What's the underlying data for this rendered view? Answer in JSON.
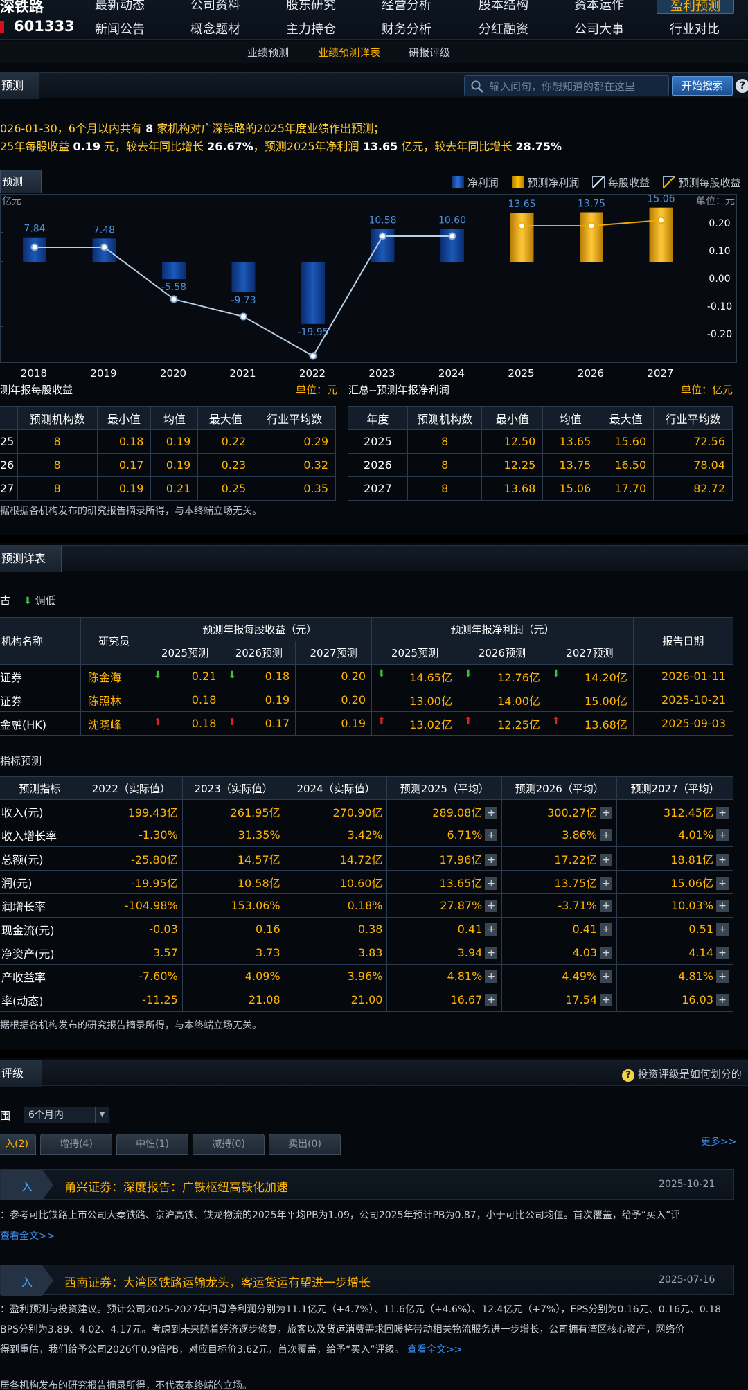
{
  "stock": {
    "name": "深铁路",
    "code": "601333"
  },
  "nav_row1": [
    "最新动态",
    "公司资料",
    "股东研究",
    "经营分析",
    "股本结构",
    "资本运作",
    "盈利预测"
  ],
  "nav_row2": [
    "新闻公告",
    "概念题材",
    "主力持仓",
    "财务分析",
    "分红融资",
    "公司大事",
    "行业对比"
  ],
  "subnav": [
    "业绩预测",
    "业绩预测详表",
    "研报评级"
  ],
  "section1": {
    "title": "预测",
    "search_placeholder": "输入问句，你想知道的都在这里",
    "search_btn": "开始搜索",
    "help": "?"
  },
  "summary": {
    "l1_a": "026-01-30，6个月以内共有",
    "l1_n": "8",
    "l1_b": "家机构对广深铁路的2025年度业绩作出预测；",
    "l2_a": "25年每股收益",
    "l2_v1": "0.19",
    "l2_b": "元，较去年同比增长",
    "l2_v2": "26.67%",
    "l2_c": "，预测2025年净利润",
    "l2_v3": "13.65",
    "l2_d": "亿元，较去年同比增长",
    "l2_v4": "28.75%"
  },
  "chart_tab": "预测",
  "legend": [
    "净利润",
    "预测净利润",
    "每股收益",
    "预测每股收益"
  ],
  "chart_data": {
    "type": "bar",
    "left_unit": "亿元",
    "right_unit": "单位：元",
    "categories": [
      "2018",
      "2019",
      "2020",
      "2021",
      "2022",
      "2023",
      "2024",
      "2025",
      "2026",
      "2027"
    ],
    "net_profit": [
      7.84,
      7.48,
      -5.58,
      -9.73,
      -19.95,
      10.58,
      10.6,
      13.65,
      13.75,
      15.06
    ],
    "forecast_from_index": 7,
    "eps_actual": [
      0.11,
      0.11,
      -0.08,
      -0.14,
      -0.28,
      0.15,
      0.15
    ],
    "eps_forecast": [
      0.19,
      0.19,
      0.21
    ],
    "right_ticks": [
      "0.20",
      "0.10",
      "0.00",
      "-0.10",
      "-0.20"
    ]
  },
  "colors": {
    "actual_bar": "#1c59b8",
    "forecast_bar": "#f2a900",
    "line_actual": "#b8cfe8",
    "line_forecast": "#f2a900",
    "label_actual": "#4e8fd8"
  },
  "eps_table": {
    "title": "测年报每股收益",
    "unit": "单位：元",
    "headers": [
      "",
      "预测机构数",
      "最小值",
      "均值",
      "最大值",
      "行业平均数"
    ],
    "rows": [
      [
        "25",
        "8",
        "0.18",
        "0.19",
        "0.22",
        "0.29"
      ],
      [
        "26",
        "8",
        "0.17",
        "0.19",
        "0.23",
        "0.32"
      ],
      [
        "27",
        "8",
        "0.19",
        "0.21",
        "0.25",
        "0.35"
      ]
    ]
  },
  "np_table": {
    "title": "汇总--预测年报净利润",
    "unit": "单位：亿元",
    "headers": [
      "年度",
      "预测机构数",
      "最小值",
      "均值",
      "最大值",
      "行业平均数"
    ],
    "rows": [
      [
        "2025",
        "8",
        "12.50",
        "13.65",
        "15.60",
        "72.56"
      ],
      [
        "2026",
        "8",
        "12.25",
        "13.75",
        "16.50",
        "78.04"
      ],
      [
        "2027",
        "8",
        "13.68",
        "15.06",
        "17.70",
        "82.72"
      ]
    ]
  },
  "note1": "据根据各机构发布的研究报告摘录所得，与本终端立场无关。",
  "section2": {
    "title": "预测详表",
    "legend_down": "调低"
  },
  "detail": {
    "h_inst": "机构名称",
    "h_analyst": "研究员",
    "h_eps": "预测年报每股收益（元）",
    "h_np": "预测年报净利润（元）",
    "h_date": "报告日期",
    "sub": [
      "2025预测",
      "2026预测",
      "2027预测",
      "2025预测",
      "2026预测",
      "2027预测"
    ],
    "rows": [
      {
        "inst": "证券",
        "analyst": "陈金海",
        "eps": [
          "0.21",
          "0.18",
          "0.20"
        ],
        "np": [
          "14.65亿",
          "12.76亿",
          "14.20亿"
        ],
        "date": "2026-01-11"
      },
      {
        "inst": "证券",
        "analyst": "陈照林",
        "eps": [
          "0.18",
          "0.19",
          "0.20"
        ],
        "np": [
          "13.00亿",
          "14.00亿",
          "15.00亿"
        ],
        "date": "2025-10-21"
      },
      {
        "inst": "金融(HK)",
        "analyst": "沈晓峰",
        "eps": [
          "0.18",
          "0.17",
          "0.19"
        ],
        "np": [
          "13.02亿",
          "12.25亿",
          "13.68亿"
        ],
        "date": "2025-09-03"
      }
    ]
  },
  "indicators": {
    "title": "指标预测",
    "headers": [
      "预测指标",
      "2022（实际值）",
      "2023（实际值）",
      "2024（实际值）",
      "预测2025（平均）",
      "预测2026（平均）",
      "预测2027（平均）"
    ],
    "rows": [
      [
        "收入(元)",
        "199.43亿",
        "261.95亿",
        "270.90亿",
        "289.08亿",
        "300.27亿",
        "312.45亿"
      ],
      [
        "收入增长率",
        "-1.30%",
        "31.35%",
        "3.42%",
        "6.71%",
        "3.86%",
        "4.01%"
      ],
      [
        "总额(元)",
        "-25.80亿",
        "14.57亿",
        "14.72亿",
        "17.96亿",
        "17.22亿",
        "18.81亿"
      ],
      [
        "润(元)",
        "-19.95亿",
        "10.58亿",
        "10.60亿",
        "13.65亿",
        "13.75亿",
        "15.06亿"
      ],
      [
        "润增长率",
        "-104.98%",
        "153.06%",
        "0.18%",
        "27.87%",
        "-3.71%",
        "10.03%"
      ],
      [
        "现金流(元)",
        "-0.03",
        "0.16",
        "0.38",
        "0.41",
        "0.41",
        "0.51"
      ],
      [
        "净资产(元)",
        "3.57",
        "3.73",
        "3.83",
        "3.94",
        "4.03",
        "4.14"
      ],
      [
        "产收益率",
        "-7.60%",
        "4.09%",
        "3.96%",
        "4.81%",
        "4.49%",
        "4.81%"
      ],
      [
        "率(动态)",
        "-11.25",
        "21.08",
        "21.00",
        "16.67",
        "17.54",
        "16.03"
      ]
    ],
    "plus": "+"
  },
  "note2": "据根据各机构发布的研究报告摘录所得，与本终端立场无关。",
  "section3": {
    "title": "评级",
    "help_text": "投资评级是如何划分的",
    "range_label": "围",
    "range_value": "6个月内",
    "tabs": [
      "入(2)",
      "增持(4)",
      "中性(1)",
      "减持(0)",
      "卖出(0)"
    ],
    "more": "更多>>"
  },
  "reports": [
    {
      "badge": "入",
      "title": "甬兴证券：深度报告：广铁枢纽高铁化加速",
      "date": "2025-10-21",
      "lines": [
        "：参考可比铁路上市公司大秦铁路、京沪高铁、铁龙物流的2025年平均PB为1.09，公司2025年预计PB为0.87，小于可比公司均值。首次覆盖，给予“买入”评"
      ],
      "link": "查看全文>>"
    },
    {
      "badge": "入",
      "title": "西南证券：大湾区铁路运输龙头，客运货运有望进一步增长",
      "date": "2025-07-16",
      "lines": [
        "：盈利预测与投资建议。预计公司2025-2027年归母净利润分别为11.1亿元（+4.7%）、11.6亿元（+4.6%）、12.4亿元（+7%），EPS分别为0.16元、0.16元、0.18",
        "BPS分别为3.89、4.02、4.17元。考虑到未来随着经济逐步修复，旅客以及货运消费需求回暖将带动相关物流服务进一步增长，公司拥有湾区核心资产，网络价",
        "得到重估，我们给予公司2026年0.9倍PB，对应目标价3.62元，首次覆盖，给予“买入”评级。"
      ],
      "link": "查看全文>>"
    }
  ],
  "footer_note": "居各机构发布的研究报告摘录所得，不代表本终端的立场。"
}
